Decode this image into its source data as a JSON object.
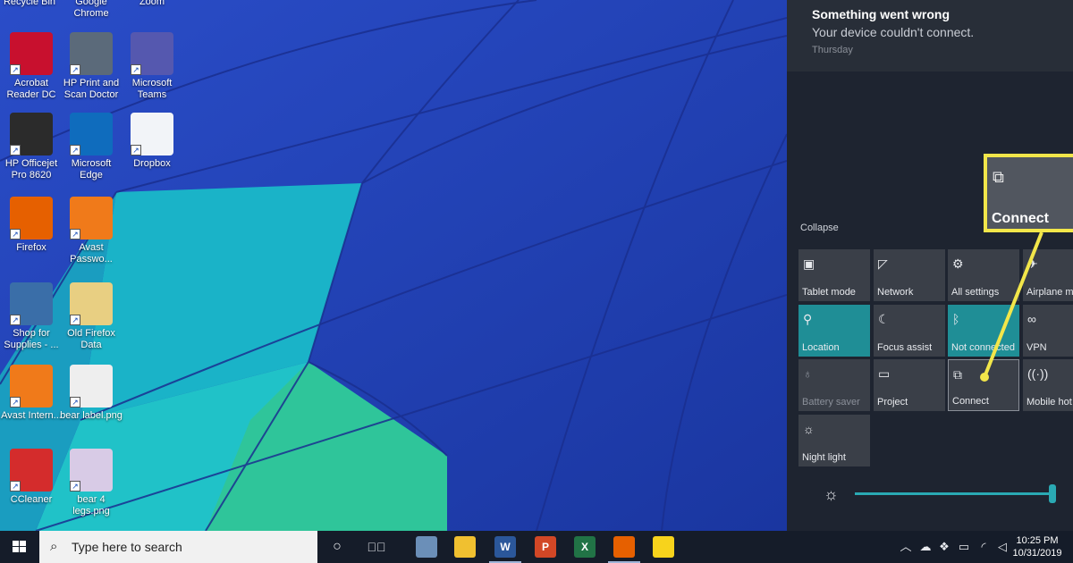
{
  "desktop": {
    "top_labels": [
      "Recycle Bin",
      "Google Chrome",
      "Zoom"
    ],
    "icons": [
      {
        "label": "Acrobat Reader DC",
        "icon": "acrobat-icon",
        "color": "#c8102e"
      },
      {
        "label": "HP Print and Scan Doctor",
        "icon": "hp-doctor-icon",
        "color": "#5b6a7a"
      },
      {
        "label": "Microsoft Teams",
        "icon": "teams-icon",
        "color": "#5558af"
      },
      {
        "label": "HP Officejet Pro 8620",
        "icon": "printer-icon",
        "color": "#2b2b2b"
      },
      {
        "label": "Microsoft Edge",
        "icon": "edge-icon",
        "color": "#0f6cbd"
      },
      {
        "label": "Dropbox",
        "icon": "dropbox-icon",
        "color": "#f2f4f8"
      },
      {
        "label": "Firefox",
        "icon": "firefox-icon",
        "color": "#e66000"
      },
      {
        "label": "Avast Passwo...",
        "icon": "key-icon",
        "color": "#f07a1a"
      },
      {
        "label": "Shop for Supplies - ...",
        "icon": "shop-supplies-icon",
        "color": "#3a6ea8"
      },
      {
        "label": "Old Firefox Data",
        "icon": "folder-icon",
        "color": "#e8cf82"
      },
      {
        "label": "Avast Intern...",
        "icon": "avast-icon",
        "color": "#f07a1a"
      },
      {
        "label": "bear label.png",
        "icon": "image-file-icon",
        "color": "#eeeeee"
      },
      {
        "label": "CCleaner",
        "icon": "ccleaner-icon",
        "color": "#d42c2c"
      },
      {
        "label": "bear 4 legs.png",
        "icon": "image-file-icon",
        "color": "#d8cbe6"
      }
    ]
  },
  "notification": {
    "title": "Something went wrong",
    "body": "Your device couldn't connect.",
    "time": "Thursday"
  },
  "quick_actions": {
    "collapse_label": "Collapse",
    "tiles": [
      {
        "label": "Tablet mode",
        "icon": "tablet-mode-icon",
        "state": "off"
      },
      {
        "label": "Network",
        "icon": "network-icon",
        "state": "off"
      },
      {
        "label": "All settings",
        "icon": "gear-icon",
        "state": "off"
      },
      {
        "label": "Airplane m",
        "icon": "airplane-icon",
        "state": "off"
      },
      {
        "label": "Location",
        "icon": "location-icon",
        "state": "on"
      },
      {
        "label": "Focus assist",
        "icon": "moon-icon",
        "state": "off"
      },
      {
        "label": "Not connected",
        "icon": "bluetooth-icon",
        "state": "on"
      },
      {
        "label": "VPN",
        "icon": "vpn-icon",
        "state": "off"
      },
      {
        "label": "Battery saver",
        "icon": "battery-saver-icon",
        "state": "disabled"
      },
      {
        "label": "Project",
        "icon": "project-icon",
        "state": "off"
      },
      {
        "label": "Connect",
        "icon": "connect-icon",
        "state": "selected"
      },
      {
        "label": "Mobile hot",
        "icon": "hotspot-icon",
        "state": "off"
      },
      {
        "label": "Night light",
        "icon": "night-light-icon",
        "state": "off"
      }
    ],
    "brightness_level": 1.0
  },
  "callout": {
    "label": "Connect",
    "border_color": "#f2e64a"
  },
  "taskbar": {
    "search_placeholder": "Type here to search",
    "pinned_apps": [
      {
        "icon": "snipping-tool-icon",
        "color": "#6b8fb8"
      },
      {
        "icon": "file-explorer-icon",
        "color": "#f0c030"
      },
      {
        "icon": "word-icon",
        "color": "#2b579a",
        "glyph": "W"
      },
      {
        "icon": "powerpoint-icon",
        "color": "#d24726",
        "glyph": "P"
      },
      {
        "icon": "excel-icon",
        "color": "#217346",
        "glyph": "X"
      },
      {
        "icon": "firefox-icon",
        "color": "#e66000"
      },
      {
        "icon": "sticky-notes-icon",
        "color": "#f7d31c"
      }
    ],
    "clock_time": "10:25 PM",
    "clock_date": "10/31/2019"
  },
  "colors": {
    "tile_on": "#1f8e96",
    "tile_off": "#3a3f48",
    "taskbar": "#151c29"
  }
}
